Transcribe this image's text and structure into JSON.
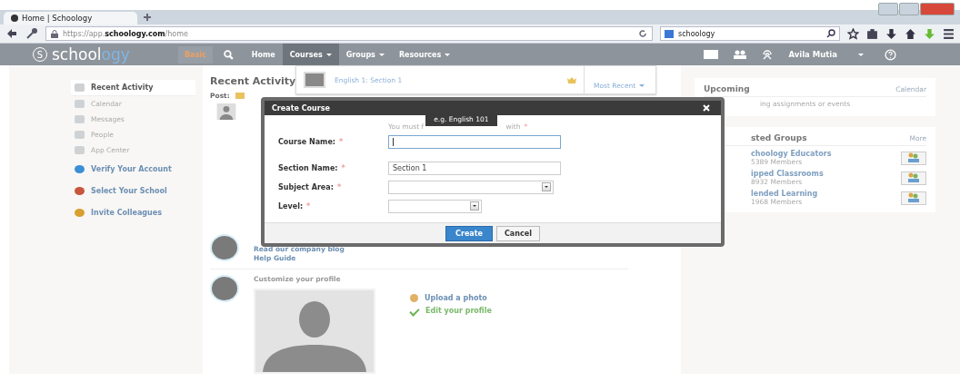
{
  "browser": {
    "tabs": [
      {
        "label": "Home | Schoology",
        "selected": true
      }
    ],
    "url_prefix": "https://app.",
    "url_domain": "schoology.com",
    "url_path": "/home",
    "search_value": "schoology"
  },
  "nav": {
    "logo_main": "school",
    "logo_accent": "ogy",
    "logo_letter": "S",
    "plan": "Basic",
    "items": [
      {
        "label": "Home",
        "has_menu": false,
        "selected": false
      },
      {
        "label": "Courses",
        "has_menu": true,
        "selected": true
      },
      {
        "label": "Groups",
        "has_menu": true,
        "selected": false
      },
      {
        "label": "Resources",
        "has_menu": true,
        "selected": false
      }
    ],
    "user": "Avila Mutia"
  },
  "courses_menu": {
    "items": [
      "English 1: Section 1"
    ],
    "filter": "Most Recent"
  },
  "sidebar": {
    "items": [
      {
        "label": "Recent Activity",
        "kind": "nav",
        "selected": true
      },
      {
        "label": "Calendar",
        "kind": "nav",
        "selected": false
      },
      {
        "label": "Messages",
        "kind": "nav",
        "selected": false
      },
      {
        "label": "People",
        "kind": "nav",
        "selected": false
      },
      {
        "label": "App Center",
        "kind": "nav",
        "selected": false
      },
      {
        "label": "Verify Your Account",
        "kind": "action",
        "selected": false
      },
      {
        "label": "Select Your School",
        "kind": "action",
        "selected": false
      },
      {
        "label": "Invite Colleagues",
        "kind": "action",
        "selected": false
      }
    ]
  },
  "feed": {
    "title": "Recent Activity",
    "post_label": "Post:",
    "links": [
      "Read our company blog",
      "Help Guide"
    ],
    "profile": {
      "title": "Customize your profile",
      "actions": [
        {
          "label": "Upload a photo",
          "kind": "upload"
        },
        {
          "label": "Edit your profile",
          "kind": "done"
        }
      ]
    }
  },
  "upcoming": {
    "title": "Upcoming",
    "link": "Calendar",
    "empty_text": "ing assignments or events"
  },
  "groups": {
    "title": "sted Groups",
    "link": "More",
    "items": [
      {
        "name": "choology Educators",
        "members": "5389 Members"
      },
      {
        "name": "ipped Classrooms",
        "members": "8932 Members"
      },
      {
        "name": "lended Learning",
        "members": "1968 Members"
      }
    ]
  },
  "dialog": {
    "title": "Create Course",
    "hint_start": "You must f",
    "hint_end": "with",
    "hint_mark": "*",
    "tooltip": "e.g. English 101",
    "fields": [
      {
        "label": "Course Name:",
        "kind": "text",
        "focused": true,
        "required_mark": "*"
      },
      {
        "label": "Section Name:",
        "kind": "text",
        "value": "Section 1",
        "focused": false,
        "required_mark": "*"
      },
      {
        "label": "Subject Area:",
        "kind": "select",
        "focused": false,
        "required_mark": "*"
      },
      {
        "label": "Level:",
        "kind": "select-short",
        "focused": false,
        "required_mark": "*"
      }
    ],
    "buttons": [
      {
        "label": "Create",
        "primary": true
      },
      {
        "label": "Cancel",
        "primary": false
      }
    ]
  }
}
